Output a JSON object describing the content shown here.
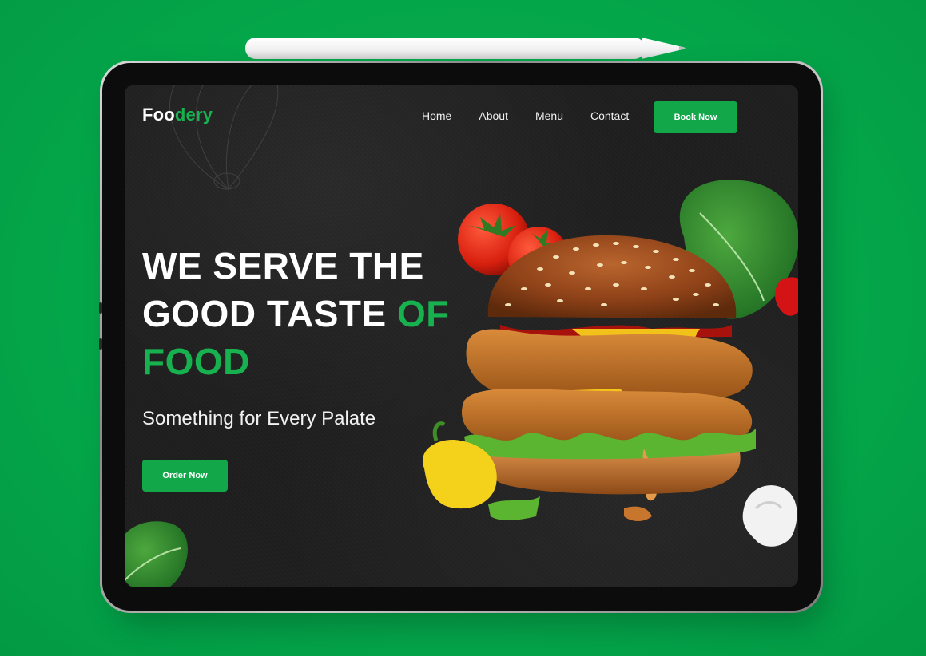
{
  "brand": {
    "logo_part1": "Foo",
    "logo_part2": "dery",
    "accent_color": "#17b14f",
    "background_color": "#04a64a"
  },
  "nav": {
    "items": [
      {
        "label": "Home"
      },
      {
        "label": "About"
      },
      {
        "label": "Menu"
      },
      {
        "label": "Contact"
      }
    ],
    "cta_label": "Book Now"
  },
  "hero": {
    "title_line1": "WE SERVE THE",
    "title_line2_white": "GOOD TASTE ",
    "title_line2_green": "OF",
    "title_line3_green": "FOOD",
    "subtitle": "Something for Every Palate",
    "cta_label": "Order Now"
  },
  "icons": {
    "decorative_whisk": "whisk-icon",
    "burger": "burger-image"
  }
}
